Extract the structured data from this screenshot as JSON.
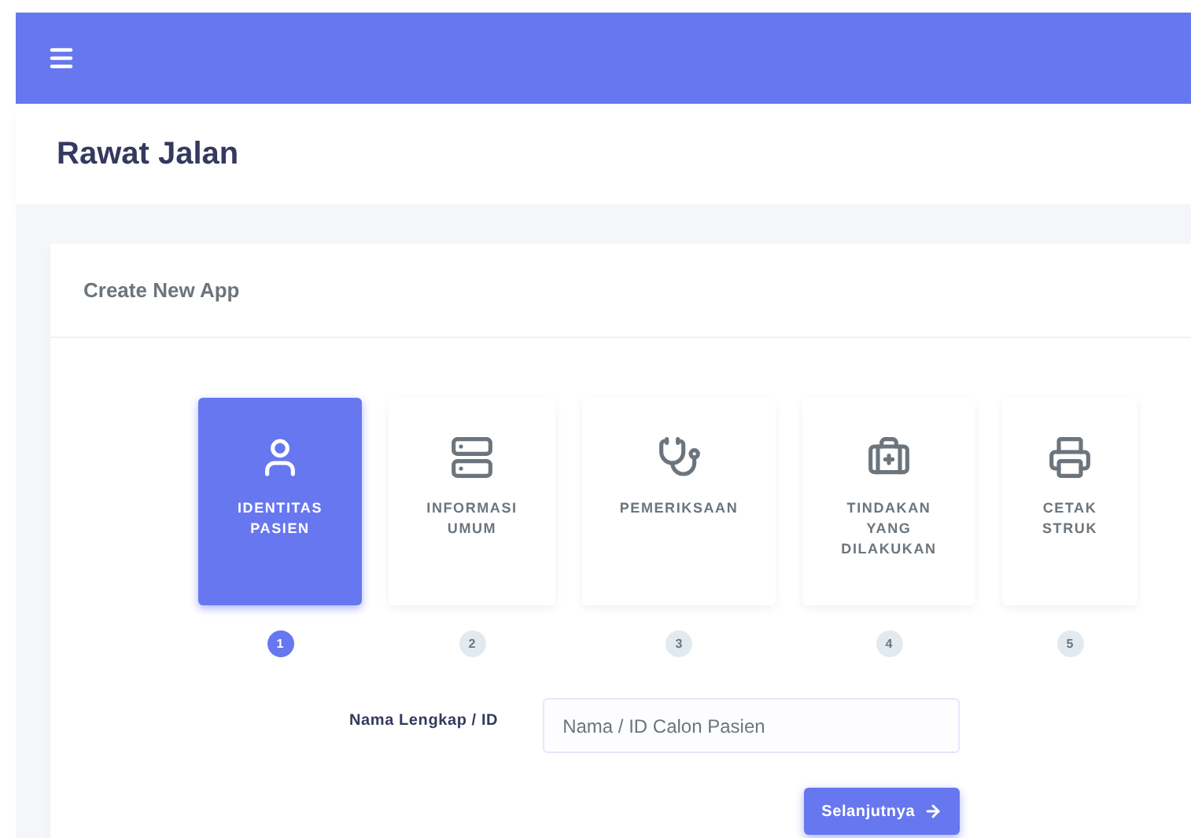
{
  "page": {
    "title": "Rawat Jalan"
  },
  "card": {
    "title": "Create New App",
    "steps": [
      {
        "kind": "user",
        "label": "IDENTITAS PASIEN",
        "number": "1",
        "selected": true
      },
      {
        "kind": "server",
        "label": "INFORMASI UMUM",
        "number": "2",
        "selected": false
      },
      {
        "kind": "stethoscope",
        "label": "PEMERIKSAAN",
        "number": "3",
        "selected": false
      },
      {
        "kind": "medkit",
        "label": "TINDAKAN YANG DILAKUKAN",
        "number": "4",
        "selected": false
      },
      {
        "kind": "printer",
        "label": "CETAK STRUK",
        "number": "5",
        "selected": false
      }
    ],
    "field": {
      "label": "Nama Lengkap / ID",
      "placeholder": "Nama / ID Calon Pasien"
    },
    "next_button": "Selanjutnya"
  }
}
